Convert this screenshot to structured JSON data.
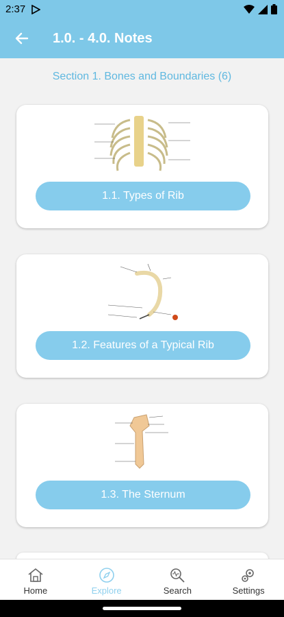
{
  "status": {
    "time": "2:37"
  },
  "appbar": {
    "title": "1.0. - 4.0. Notes"
  },
  "section": {
    "title": "Section 1. Bones and Boundaries (6)"
  },
  "cards": [
    {
      "label": "1.1. Types of Rib"
    },
    {
      "label": "1.2. Features of a Typical Rib"
    },
    {
      "label": "1.3. The Sternum"
    }
  ],
  "nav": [
    {
      "label": "Home",
      "icon": "home-icon"
    },
    {
      "label": "Explore",
      "icon": "compass-icon",
      "active": true
    },
    {
      "label": "Search",
      "icon": "search-icon"
    },
    {
      "label": "Settings",
      "icon": "gear-icon"
    }
  ],
  "colors": {
    "accent": "#7ec8e8",
    "button": "#86ccec",
    "section_title": "#5fb8e0",
    "nav_active": "#8fd0ee"
  }
}
